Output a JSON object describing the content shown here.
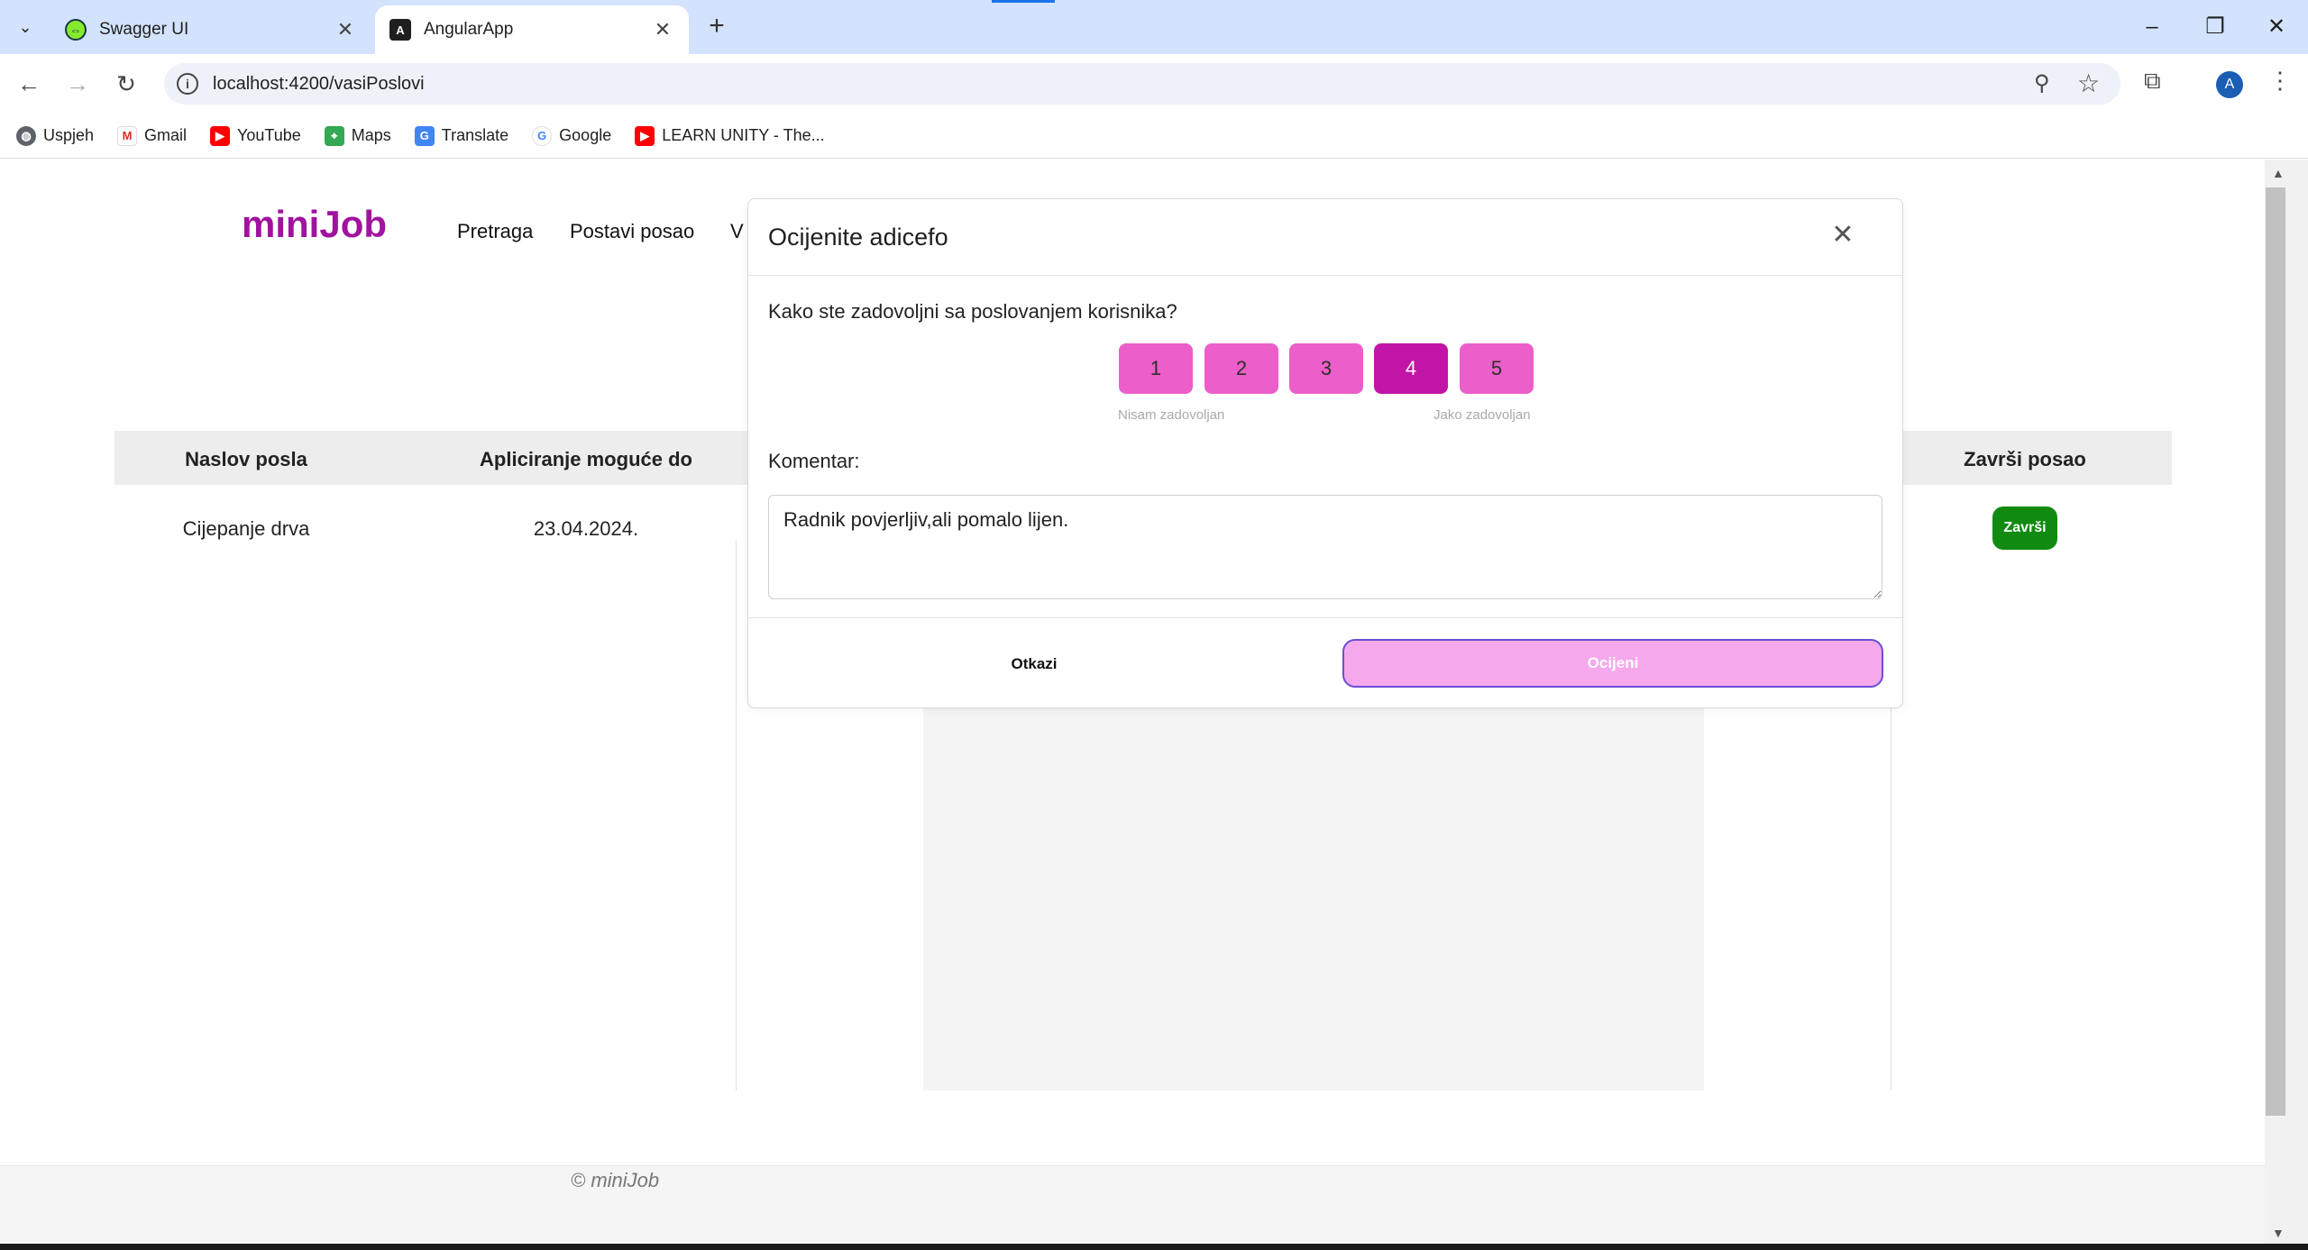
{
  "browser": {
    "tabs": [
      {
        "title": "Swagger UI",
        "icon": "swagger-icon",
        "active": false
      },
      {
        "title": "AngularApp",
        "icon": "angular-icon",
        "active": true
      }
    ],
    "url": "localhost:4200/vasiPoslovi",
    "avatar_letter": "A",
    "bookmarks": [
      {
        "label": "Uspjeh",
        "icon": "globe-icon"
      },
      {
        "label": "Gmail",
        "icon": "gmail-icon"
      },
      {
        "label": "YouTube",
        "icon": "youtube-icon"
      },
      {
        "label": "Maps",
        "icon": "maps-icon"
      },
      {
        "label": "Translate",
        "icon": "translate-icon"
      },
      {
        "label": "Google",
        "icon": "google-icon"
      },
      {
        "label": "LEARN UNITY - The...",
        "icon": "youtube-icon"
      }
    ]
  },
  "app": {
    "logo": "miniJob",
    "nav": [
      "Pretraga",
      "Postavi posao",
      "V"
    ],
    "table": {
      "headers": [
        "Naslov posla",
        "Apliciranje moguće do",
        "Završi posao"
      ],
      "rows": [
        {
          "title": "Cijepanje drva",
          "deadline": "23.04.2024.",
          "action": "Završi"
        }
      ]
    },
    "footer": "© miniJob"
  },
  "modal": {
    "title": "Ocijenite adicefo",
    "question": "Kako ste zadovoljni sa poslovanjem korisnika?",
    "ratings": [
      "1",
      "2",
      "3",
      "4",
      "5"
    ],
    "selected_rating": 4,
    "scale_low": "Nisam zadovoljan",
    "scale_high": "Jako zadovoljan",
    "comment_label": "Komentar:",
    "comment_value": "Radnik povjerljiv,ali pomalo lijen.",
    "cancel_label": "Otkazi",
    "submit_label": "Ocijeni"
  },
  "colors": {
    "brand": "#a0139f",
    "rating": "#ec5ec9",
    "rating_selected": "#c215a7",
    "success": "#118a11",
    "submit": "#f5a8ec"
  }
}
